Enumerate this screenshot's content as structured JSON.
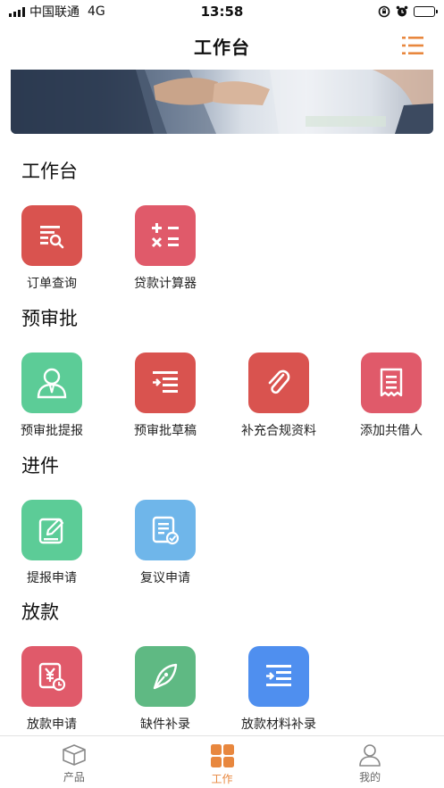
{
  "status_bar": {
    "carrier": "中国联通",
    "network": "4G",
    "time": "13:58"
  },
  "nav": {
    "title": "工作台",
    "menu_icon": "list-menu-icon"
  },
  "sections": [
    {
      "title": "工作台",
      "items": [
        {
          "label": "订单查询",
          "icon": "order-search-icon",
          "color": "#d9534f"
        },
        {
          "label": "贷款计算器",
          "icon": "calculator-icon",
          "color": "#e05a6a"
        }
      ]
    },
    {
      "title": "预审批",
      "items": [
        {
          "label": "预审批提报",
          "icon": "person-icon",
          "color": "#5ccc97"
        },
        {
          "label": "预审批草稿",
          "icon": "draft-list-icon",
          "color": "#d9534f"
        },
        {
          "label": "补充合规资料",
          "icon": "paperclip-icon",
          "color": "#d9534f"
        },
        {
          "label": "添加共借人",
          "icon": "receipt-icon",
          "color": "#e05a6a"
        }
      ]
    },
    {
      "title": "进件",
      "items": [
        {
          "label": "提报申请",
          "icon": "edit-icon",
          "color": "#5ccc97"
        },
        {
          "label": "复议申请",
          "icon": "review-document-icon",
          "color": "#6fb6ea"
        }
      ]
    },
    {
      "title": "放款",
      "items": [
        {
          "label": "放款申请",
          "icon": "yuan-clock-icon",
          "color": "#e05a6a"
        },
        {
          "label": "缺件补录",
          "icon": "pen-nib-icon",
          "color": "#5fb983"
        },
        {
          "label": "放款材料补录",
          "icon": "material-list-icon",
          "color": "#4f8fef"
        }
      ]
    }
  ],
  "tabbar": {
    "active_color": "#e8873e",
    "items": [
      {
        "label": "产品",
        "icon": "box-icon"
      },
      {
        "label": "工作",
        "icon": "grid-icon"
      },
      {
        "label": "我的",
        "icon": "user-icon"
      }
    ]
  }
}
